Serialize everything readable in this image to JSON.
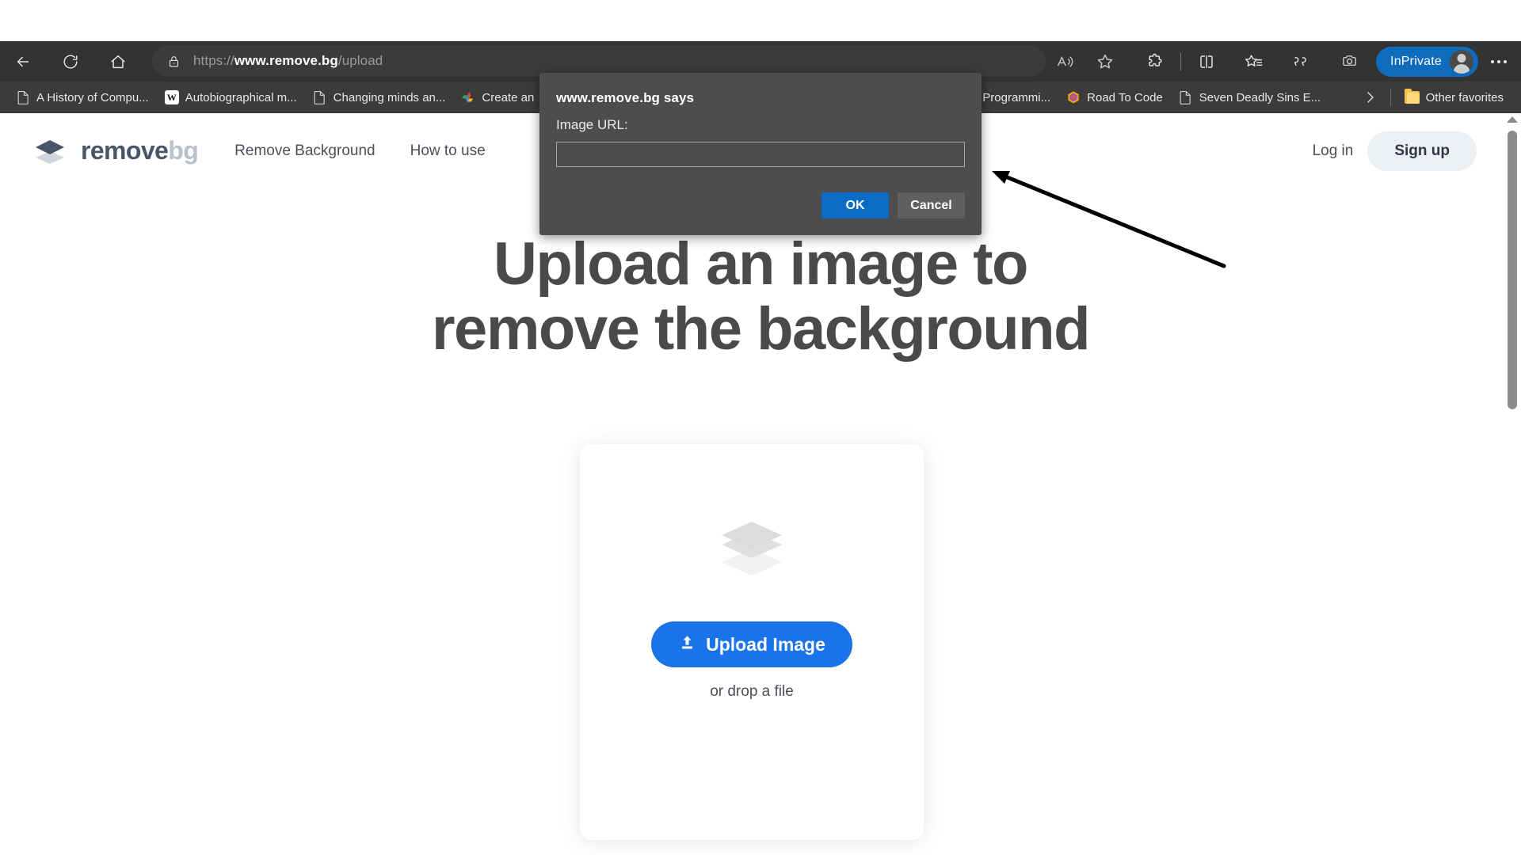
{
  "browser": {
    "nav": {
      "back_icon": "arrow-left-icon",
      "reload_icon": "reload-icon",
      "home_icon": "home-icon"
    },
    "address_bar": {
      "lock_icon": "lock-icon",
      "scheme": "https://",
      "host": "www.remove.bg",
      "path": "/upload",
      "full_url": "https://www.remove.bg/upload"
    },
    "toolbar_icons": [
      {
        "name": "read-aloud-icon"
      },
      {
        "name": "favorite-star-icon"
      },
      {
        "name": "extensions-puzzle-icon"
      },
      {
        "name": "split-screen-icon"
      },
      {
        "name": "favorites-list-icon"
      },
      {
        "name": "collections-icon"
      },
      {
        "name": "screenshot-icon"
      }
    ],
    "profile": {
      "label": "InPrivate",
      "avatar_icon": "person-avatar-icon"
    },
    "settings_icon": "more-ellipsis-icon",
    "bookmarks": [
      {
        "label": "A History of Compu...",
        "icon": "page-icon"
      },
      {
        "label": "Autobiographical m...",
        "icon": "wikipedia-icon"
      },
      {
        "label": "Changing minds an...",
        "icon": "page-icon"
      },
      {
        "label": "Create an",
        "icon": "google-cloud-icon"
      },
      {
        "label": "Programmi...",
        "icon": "page-icon"
      },
      {
        "label": "Road To Code",
        "icon": "hexagon-icon"
      },
      {
        "label": "Seven Deadly Sins E...",
        "icon": "page-icon"
      }
    ],
    "bookmarks_overflow_icon": "chevron-right-icon",
    "other_favorites": {
      "label": "Other favorites",
      "icon": "folder-icon"
    }
  },
  "dialog": {
    "title": "www.remove.bg says",
    "label": "Image URL:",
    "input_value": "",
    "input_placeholder": "",
    "ok_label": "OK",
    "cancel_label": "Cancel",
    "ok_color": "#0a6cc4",
    "cancel_color": "#5f5f5f",
    "background": "#4d4d4d"
  },
  "site": {
    "logo": {
      "text_primary": "remove",
      "text_secondary": "bg",
      "icon": "layers-diamond-icon"
    },
    "nav": [
      {
        "label": "Remove Background"
      },
      {
        "label": "How to use"
      }
    ],
    "auth": {
      "login_label": "Log in",
      "signup_label": "Sign up"
    },
    "hero": {
      "line1": "Upload an image to",
      "line2": "remove the background"
    },
    "upload_card": {
      "stack_icon": "layers-diamond-icon",
      "button_label": "Upload Image",
      "button_icon": "upload-arrow-icon",
      "button_color": "#1a73e8",
      "drop_text": "or drop a file"
    }
  },
  "scrollbar": {
    "up_arrow_icon": "scroll-up-arrow-icon",
    "thumb_name": "page-scroll-thumb"
  },
  "annotation": {
    "arrow_name": "pointer-arrow-annotation",
    "color": "#000000"
  }
}
